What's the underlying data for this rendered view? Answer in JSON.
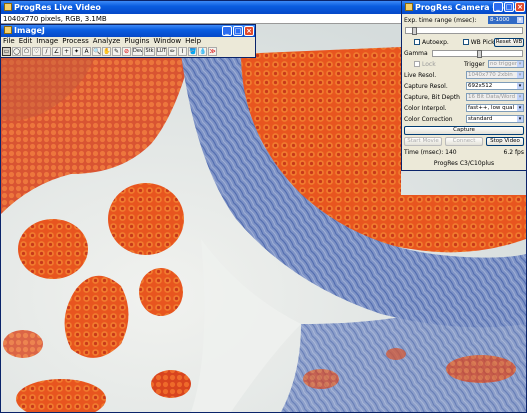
{
  "live_window": {
    "title": "ProgRes Live Video",
    "info": "1040x770 pixels, RGB, 3.1MB"
  },
  "imagej": {
    "title": "ImageJ",
    "menu": [
      "File",
      "Edit",
      "Image",
      "Process",
      "Analyze",
      "Plugins",
      "Window",
      "Help"
    ],
    "tools": [
      "rectangle-tool",
      "oval-tool",
      "polygon-tool",
      "freehand-tool",
      "straight-line-tool",
      "angle-tool",
      "point-tool",
      "wand-tool",
      "text-tool",
      "magnifying-glass-tool",
      "scrolling-tool",
      "color-picker-tool",
      "stop-tool",
      "dev-tool",
      "stk-tool",
      "lut-tool",
      "pencil-tool",
      "brush-tool",
      "flood-fill-tool",
      "dropper-tool",
      "more-tools-menu"
    ],
    "tool_glyphs": [
      "▭",
      "◯",
      "⬠",
      "♡",
      "∕",
      "∠",
      "+",
      "✦",
      "A",
      "🔍",
      "✋",
      "✎",
      "⊘",
      "Dev",
      "Stk",
      "LUT",
      "✏",
      "⌇",
      "🪣",
      "💧",
      "≫"
    ]
  },
  "camera_control": {
    "title": "ProgRes Camera Con...",
    "exp_label": "Exp. time range (msec):",
    "exp_value": "8-1000",
    "exposure_slider": 0.05,
    "autoexp_label": "Autoexp.",
    "wb_pick_label": "WB Pick",
    "reset_wb_label": "Reset WB",
    "gamma_label": "Gamma",
    "gamma_slider": 0.52,
    "lock_label": "Lock",
    "trigger_label": "Trigger",
    "trigger_value": "no trigger",
    "live_resol_label": "Live Resol.",
    "live_resol_value": "1040x770 2xbin",
    "capture_resol_label": "Capture Resol.",
    "capture_resol_value": "692x512",
    "bit_depth_label": "Capture, Bit Depth",
    "bit_depth_value": "16 Bit Data/Word",
    "color_interpol_label": "Color Interpol.",
    "color_interpol_value": "fast++, low qual",
    "color_correction_label": "Color Correction",
    "color_correction_value": "standard",
    "capture_label": "Capture",
    "start_movie_label": "Start Movie",
    "connect_label": "Connect",
    "stop_video_label": "Stop Video",
    "time_label": "Time (msec): 140",
    "fps_label": "6.2 fps",
    "camera_model": "ProgRes C3/C10plus"
  },
  "colors": {
    "tissue_blue": "#6c88c4",
    "cell_red": "#e0461c",
    "background_white": "#e9ecea"
  }
}
